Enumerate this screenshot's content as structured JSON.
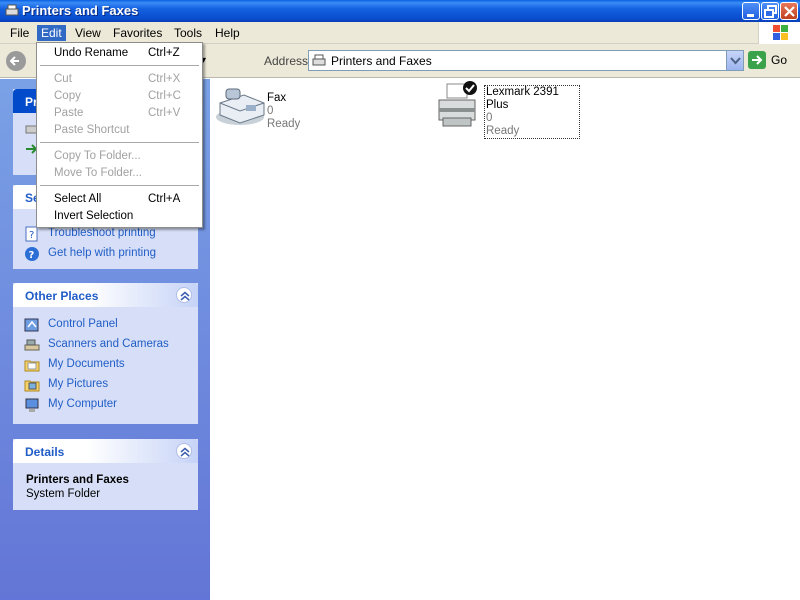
{
  "window": {
    "title": "Printers and Faxes"
  },
  "menubar": {
    "file": "File",
    "edit": "Edit",
    "view": "View",
    "favorites": "Favorites",
    "tools": "Tools",
    "help": "Help"
  },
  "toolbar": {
    "address_label": "Address",
    "address_value": "Printers and Faxes",
    "go_label": "Go"
  },
  "edit_menu": {
    "undo": {
      "label": "Undo Rename",
      "shortcut": "Ctrl+Z"
    },
    "cut": {
      "label": "Cut",
      "shortcut": "Ctrl+X"
    },
    "copy": {
      "label": "Copy",
      "shortcut": "Ctrl+C"
    },
    "paste": {
      "label": "Paste",
      "shortcut": "Ctrl+V"
    },
    "paste_shortcut": {
      "label": "Paste Shortcut"
    },
    "copy_to_folder": {
      "label": "Copy To Folder..."
    },
    "move_to_folder": {
      "label": "Move To Folder..."
    },
    "select_all": {
      "label": "Select All",
      "shortcut": "Ctrl+A"
    },
    "invert_selection": {
      "label": "Invert Selection"
    }
  },
  "taskpane": {
    "printer_tasks": {
      "title": "Pri"
    },
    "see_also": {
      "title": "Se",
      "links": [
        "Troubleshoot printing",
        "Get help with printing"
      ]
    },
    "other_places": {
      "title": "Other Places",
      "links": [
        "Control Panel",
        "Scanners and Cameras",
        "My Documents",
        "My Pictures",
        "My Computer"
      ]
    },
    "details": {
      "title": "Details",
      "name": "Printers and Faxes",
      "type": "System Folder"
    }
  },
  "items": [
    {
      "name": "Fax",
      "documents": "0",
      "status": "Ready"
    },
    {
      "name": "Lexmark 2391 Plus",
      "documents": "0",
      "status": "Ready"
    }
  ],
  "colors": {
    "accent": "#316ac5",
    "link": "#215dc6",
    "titlebar": "#0a4fd0"
  }
}
